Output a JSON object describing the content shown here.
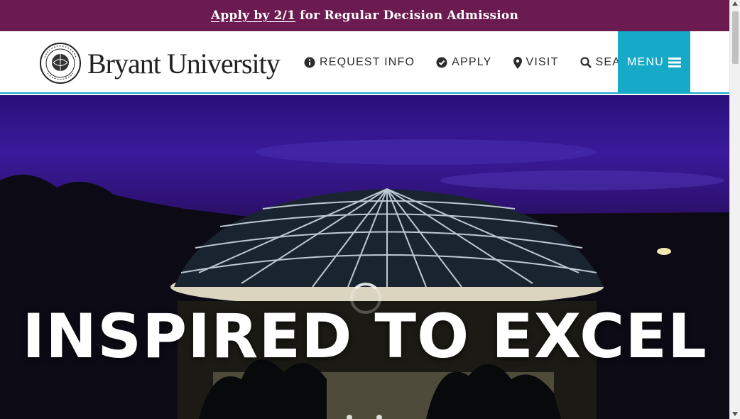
{
  "announcement": {
    "link_text": "Apply by 2/1",
    "rest_text": "for Regular Decision Admission"
  },
  "header": {
    "logo_text": "Bryant University",
    "seal_text": "BRYANT UNIVERSITY 1863",
    "nav": [
      {
        "label": "REQUEST INFO",
        "icon": "info-circle-icon"
      },
      {
        "label": "APPLY",
        "icon": "check-circle-icon"
      },
      {
        "label": "VISIT",
        "icon": "map-marker-icon"
      },
      {
        "label": "SEARCH",
        "icon": "search-icon"
      }
    ],
    "menu_label": "MENU",
    "menu_icon": "hamburger-icon"
  },
  "hero": {
    "headline": "INSPIRED TO EXCEL"
  },
  "colors": {
    "announcement_bg": "#6b1b4f",
    "menu_bg": "#16a9c8",
    "header_border": "#1ba6c9"
  }
}
